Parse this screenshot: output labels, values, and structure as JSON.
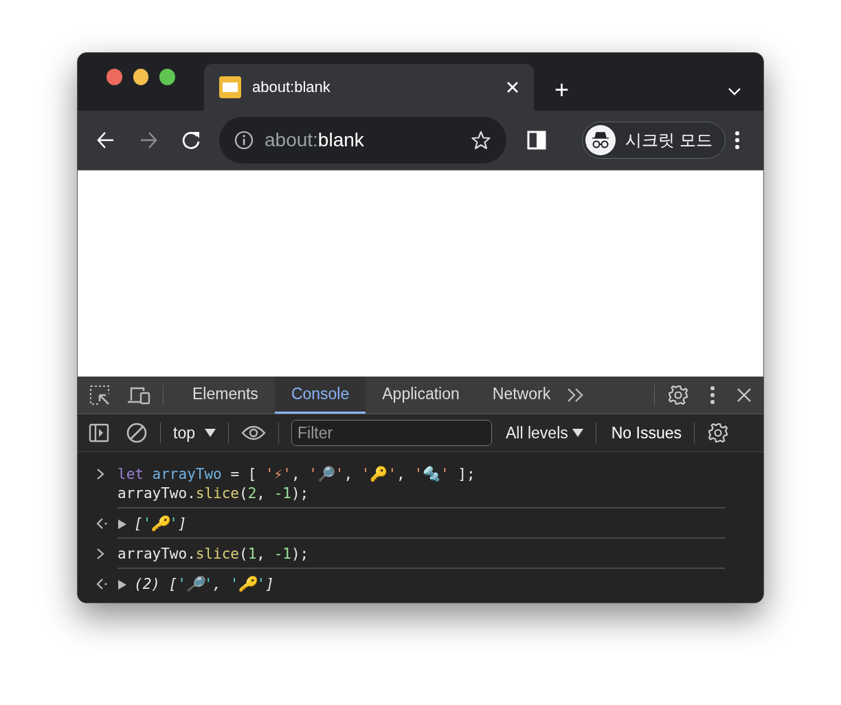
{
  "tabs": [
    {
      "title": "about:blank",
      "selected": true
    }
  ],
  "tab_strip": {
    "new_tab": "+"
  },
  "toolbar": {
    "back_disabled": false,
    "forward_disabled": true,
    "url_scheme": "about:",
    "url_rest": "blank",
    "profile_label": "시크릿 모드"
  },
  "devtools": {
    "tabs": [
      {
        "label": "Elements",
        "selected": false
      },
      {
        "label": "Console",
        "selected": true
      },
      {
        "label": "Application",
        "selected": false
      },
      {
        "label": "Network",
        "selected": false
      }
    ],
    "context": "top",
    "filter_placeholder": "Filter",
    "levels": "All levels",
    "issues": "No Issues",
    "entries": [
      {
        "kind": "input",
        "lines": [
          [
            {
              "kind": "keyword",
              "text": "let "
            },
            {
              "kind": "variable",
              "text": "arrayTwo"
            },
            {
              "kind": "plain",
              "text": " = [ "
            },
            {
              "kind": "string",
              "text": "'⚡'"
            },
            {
              "kind": "plain",
              "text": ", "
            },
            {
              "kind": "string",
              "text": "'🔎'"
            },
            {
              "kind": "plain",
              "text": ", "
            },
            {
              "kind": "string",
              "text": "'🔑'"
            },
            {
              "kind": "plain",
              "text": ", "
            },
            {
              "kind": "string",
              "text": "'🔩'"
            },
            {
              "kind": "plain",
              "text": " ];"
            }
          ],
          [
            {
              "kind": "plain",
              "text": "arrayTwo."
            },
            {
              "kind": "method",
              "text": "slice"
            },
            {
              "kind": "plain",
              "text": "("
            },
            {
              "kind": "number",
              "text": "2"
            },
            {
              "kind": "plain",
              "text": ", "
            },
            {
              "kind": "number",
              "text": "-1"
            },
            {
              "kind": "plain",
              "text": ");"
            }
          ]
        ]
      },
      {
        "kind": "output",
        "lines": [
          [
            {
              "kind": "plain",
              "text": "["
            },
            {
              "kind": "quote",
              "text": "'"
            },
            {
              "kind": "plain",
              "text": "🔑"
            },
            {
              "kind": "quote",
              "text": "'"
            },
            {
              "kind": "plain",
              "text": "]"
            }
          ]
        ]
      },
      {
        "kind": "input",
        "lines": [
          [
            {
              "kind": "plain",
              "text": "arrayTwo."
            },
            {
              "kind": "method",
              "text": "slice"
            },
            {
              "kind": "plain",
              "text": "("
            },
            {
              "kind": "number",
              "text": "1"
            },
            {
              "kind": "plain",
              "text": ", "
            },
            {
              "kind": "number",
              "text": "-1"
            },
            {
              "kind": "plain",
              "text": ");"
            }
          ]
        ]
      },
      {
        "kind": "output",
        "lines": [
          [
            {
              "kind": "plain",
              "text": "(2) ["
            },
            {
              "kind": "quote",
              "text": "'"
            },
            {
              "kind": "plain",
              "text": "🔎"
            },
            {
              "kind": "quote",
              "text": "'"
            },
            {
              "kind": "plain",
              "text": ", "
            },
            {
              "kind": "quote",
              "text": "'"
            },
            {
              "kind": "plain",
              "text": "🔑"
            },
            {
              "kind": "quote",
              "text": "'"
            },
            {
              "kind": "plain",
              "text": "]"
            }
          ]
        ]
      }
    ]
  }
}
